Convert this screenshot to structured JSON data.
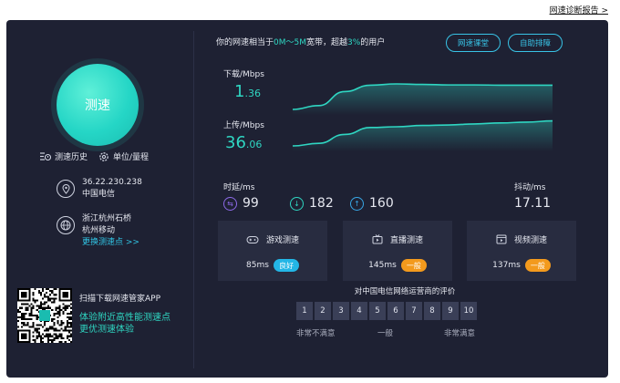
{
  "top_link": "网速诊断报告 >",
  "left": {
    "speed_button": "测速",
    "history": "测速历史",
    "units": "单位/量程",
    "ip": "36.22.230.238",
    "isp": "中国电信",
    "server_location": "浙江杭州石桥",
    "server_isp": "杭州移动",
    "change_server": "更换测速点 >>",
    "promo_title": "扫描下载网速管家APP",
    "promo_line1": "体验附近高性能测速点",
    "promo_line2": "更优测速体验"
  },
  "summary": {
    "prefix": "你的网速相当于",
    "band": "0M～5M",
    "mid": "宽带，超越",
    "percent": "3%",
    "suffix": "的用户"
  },
  "buttons": {
    "course": "网速课堂",
    "auto": "自助排障"
  },
  "download": {
    "label": "下载/Mbps",
    "int": "1",
    "dec": ".36",
    "curve": [
      0.0,
      0.15,
      0.7,
      0.95,
      1.0,
      0.98,
      0.96,
      0.96,
      0.95,
      0.95,
      0.95
    ]
  },
  "upload": {
    "label": "上传/Mbps",
    "int": "36",
    "dec": ".06",
    "curve": [
      0.0,
      0.1,
      0.45,
      0.72,
      0.75,
      0.8,
      0.82,
      0.86,
      0.9,
      0.93,
      0.98
    ]
  },
  "latency": {
    "label": "时延/ms",
    "avg": "99",
    "down": "182",
    "up": "160"
  },
  "jitter": {
    "label": "抖动/ms",
    "value": "17.11"
  },
  "cards": [
    {
      "title": "游戏测速",
      "value": "85ms",
      "badge": "良好",
      "badge_color": "#23b6e6"
    },
    {
      "title": "直播测速",
      "value": "145ms",
      "badge": "一般",
      "badge_color": "#f39a1d"
    },
    {
      "title": "视频测速",
      "value": "137ms",
      "badge": "一般",
      "badge_color": "#f39a1d"
    }
  ],
  "rating": {
    "title": "对中国电信网络运营商的评价",
    "scores": [
      "1",
      "2",
      "3",
      "4",
      "5",
      "6",
      "7",
      "8",
      "9",
      "10"
    ],
    "low": "非常不满意",
    "mid": "一般",
    "high": "非常满意"
  },
  "colors": {
    "panel": "#1e2133",
    "accent": "#2fd6c2",
    "link": "#31c6e6"
  }
}
